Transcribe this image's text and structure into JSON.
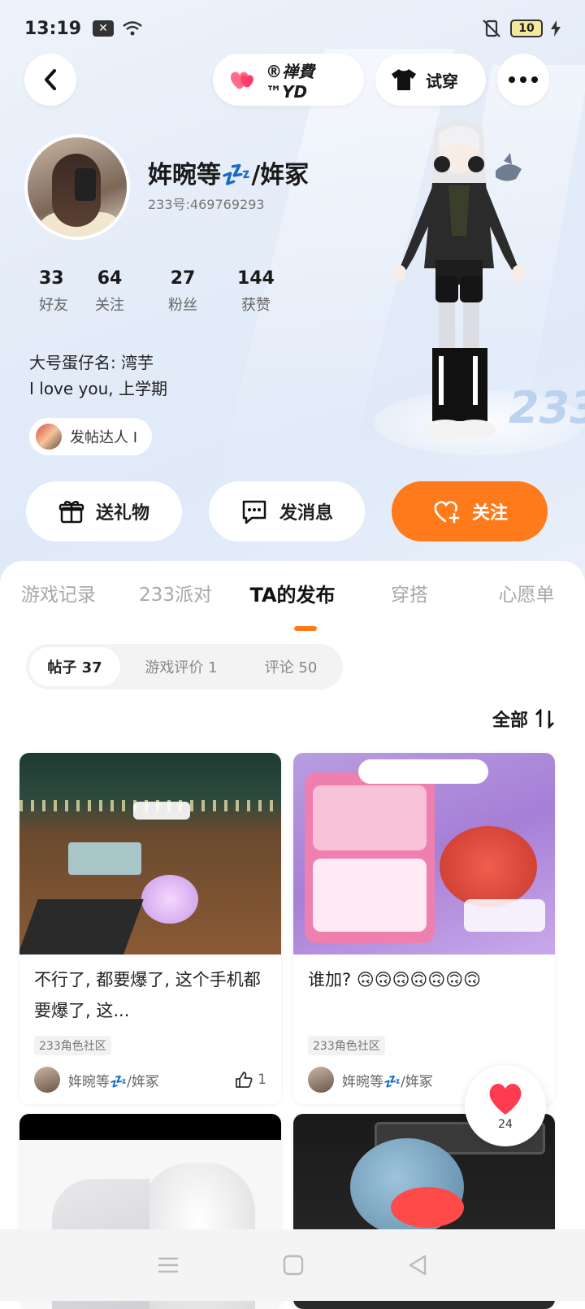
{
  "status_bar": {
    "time": "13:19",
    "battery": "10",
    "notif_box": "✕"
  },
  "top_nav": {
    "partner_name": "®禅費™YD",
    "try_on_label": "试穿"
  },
  "profile": {
    "username": "姩晼等💤/姩冢",
    "user_id": "233号:469769293",
    "stats": [
      {
        "value": "33",
        "label": "好友"
      },
      {
        "value": "64",
        "label": "关注"
      },
      {
        "value": "27",
        "label": "粉丝"
      },
      {
        "value": "144",
        "label": "获赞"
      }
    ],
    "bio_line1": "大号蛋仔名: 湾芋",
    "bio_line2": "I love you, 上学期",
    "badge": "发帖达人 I",
    "character_badge": "233"
  },
  "actions": {
    "gift_label": "送礼物",
    "message_label": "发消息",
    "follow_label": "关注"
  },
  "tabs": [
    "游戏记录",
    "233派对",
    "TA的发布",
    "穿搭",
    "心愿单"
  ],
  "segments": [
    "帖子 37",
    "游戏评价 1",
    "评论 50"
  ],
  "sort_label": "全部",
  "posts": [
    {
      "title": "不行了, 都要爆了, 这个手机都要爆了, 这...",
      "tag": "233角色社区",
      "author": "姩晼等💤/姩冢",
      "likes": "1"
    },
    {
      "title": "谁加? 🙃🙃🙃🙃🙃🙃🙃",
      "tag": "233角色社区",
      "author": "姩晼等💤/姩冢",
      "likes": ""
    }
  ],
  "float_heart_count": "24",
  "accent_color": "#ff7a1a"
}
